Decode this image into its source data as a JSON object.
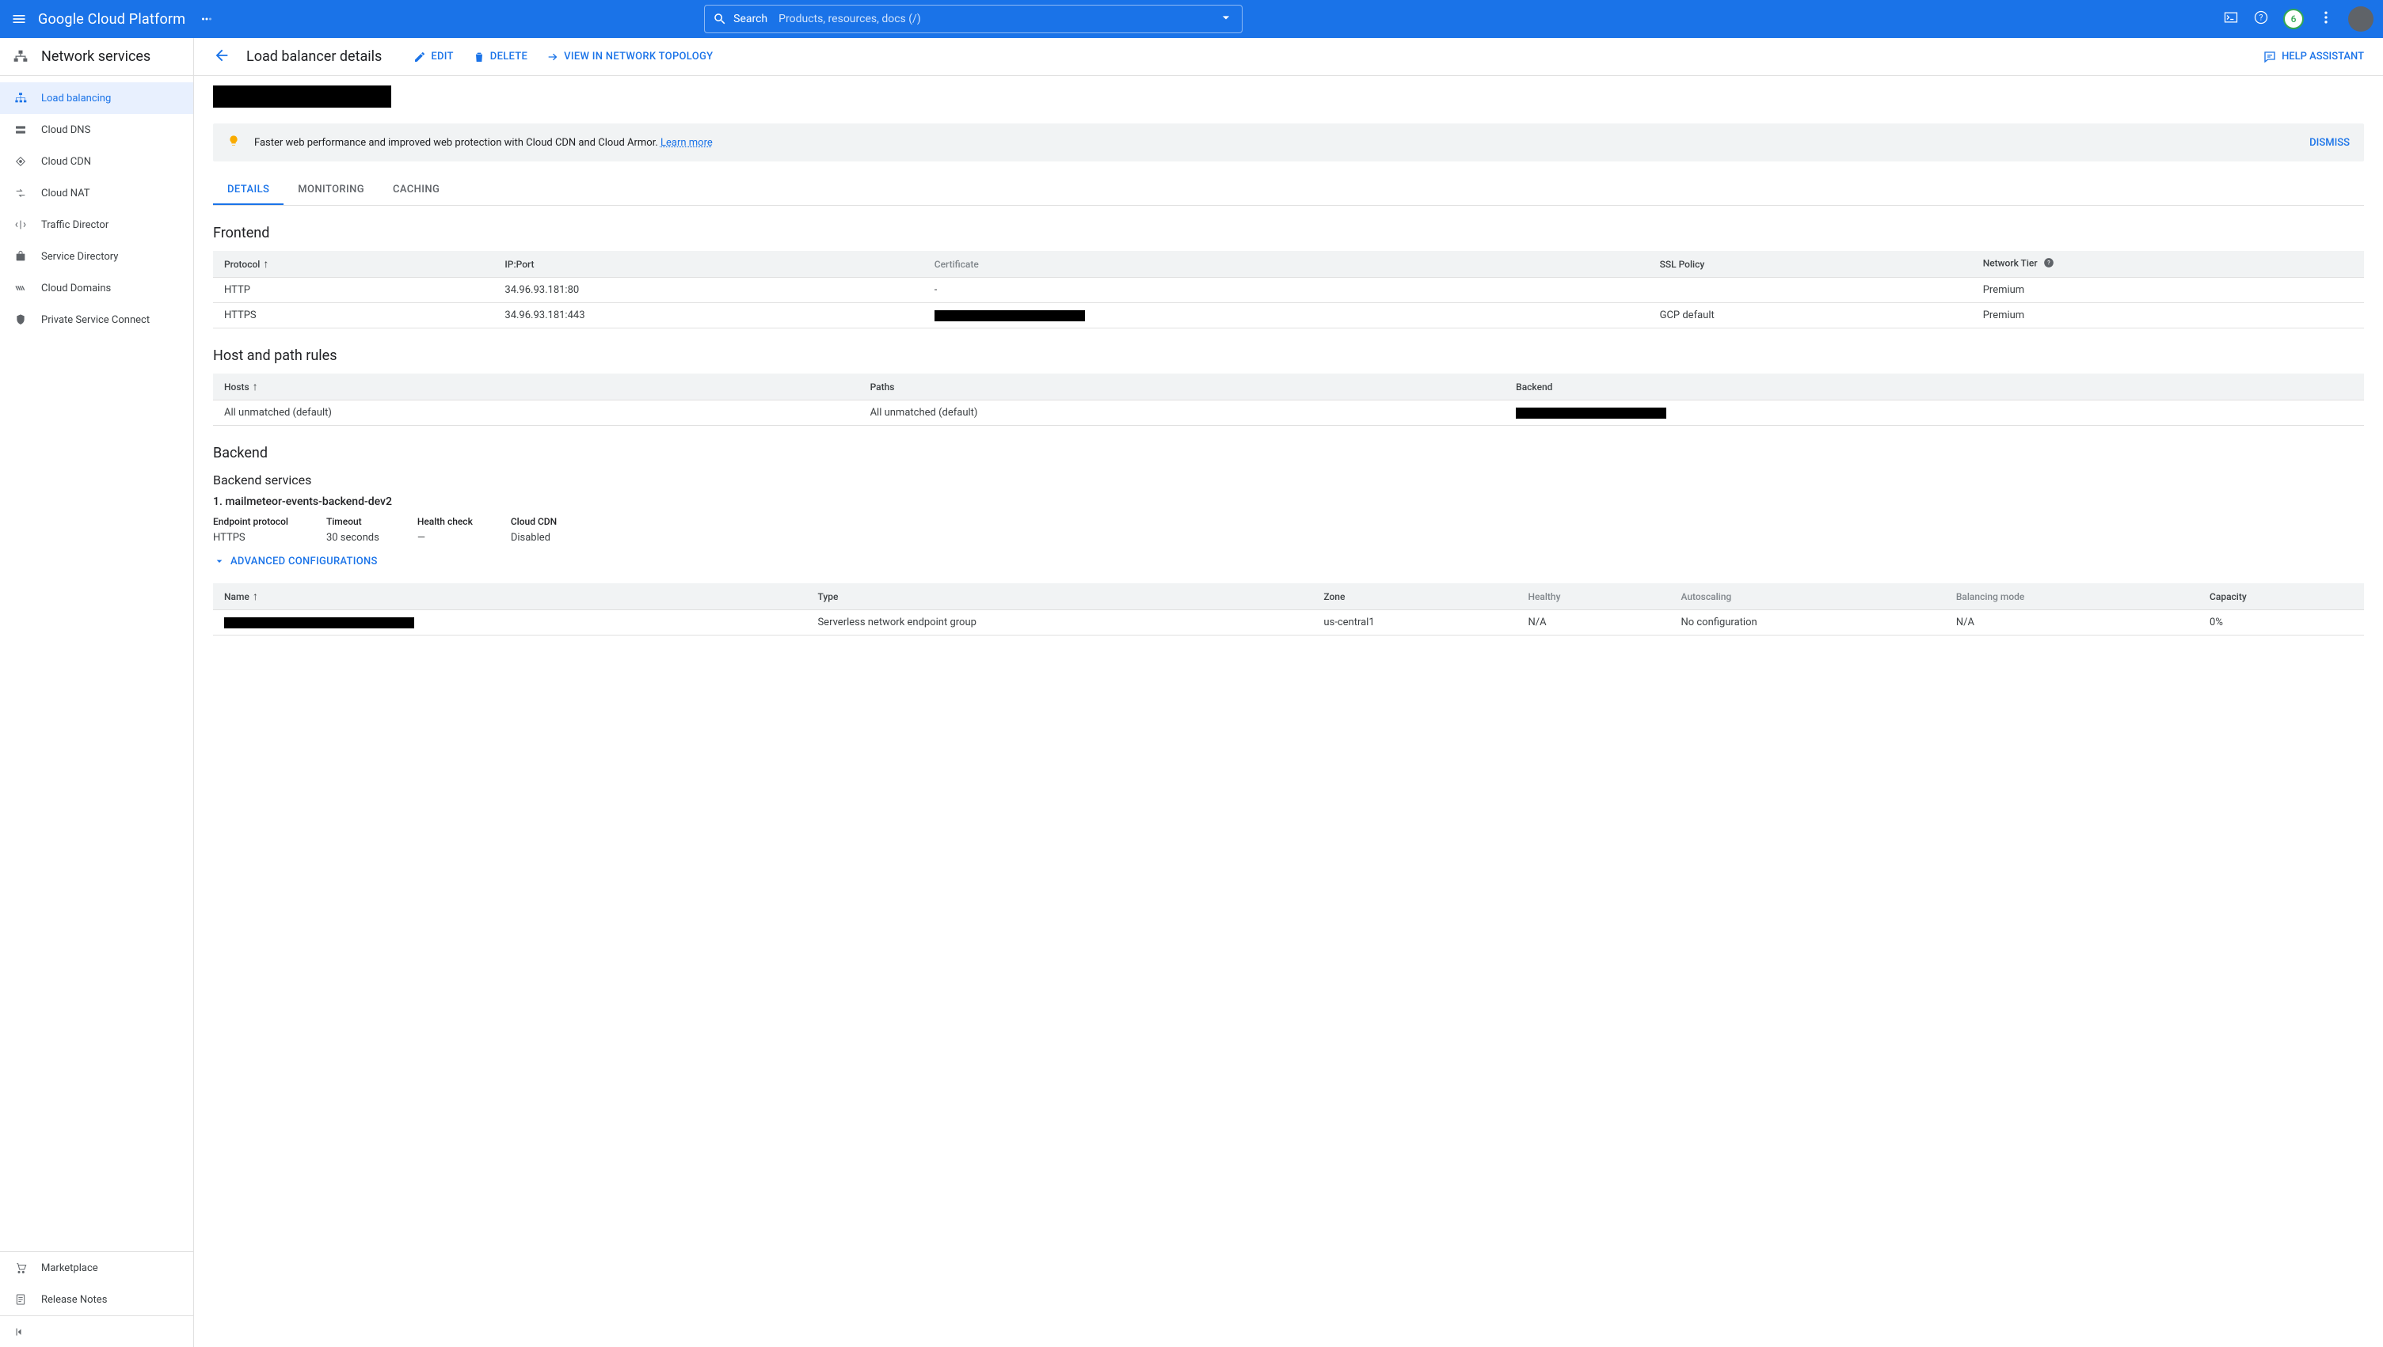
{
  "topbar": {
    "logo": "Google Cloud Platform",
    "search_label": "Search",
    "search_placeholder": "Products, resources, docs (/)",
    "badge": "6"
  },
  "sidebar": {
    "title": "Network services",
    "items": [
      {
        "label": "Load balancing"
      },
      {
        "label": "Cloud DNS"
      },
      {
        "label": "Cloud CDN"
      },
      {
        "label": "Cloud NAT"
      },
      {
        "label": "Traffic Director"
      },
      {
        "label": "Service Directory"
      },
      {
        "label": "Cloud Domains"
      },
      {
        "label": "Private Service Connect"
      }
    ],
    "bottom": [
      {
        "label": "Marketplace"
      },
      {
        "label": "Release Notes"
      }
    ]
  },
  "page": {
    "title": "Load balancer details",
    "actions": {
      "edit": "EDIT",
      "delete": "DELETE",
      "topology": "VIEW IN NETWORK TOPOLOGY"
    },
    "help": "HELP ASSISTANT"
  },
  "banner": {
    "text": "Faster web performance and improved web protection with Cloud CDN and Cloud Armor. ",
    "learn": "Learn more",
    "dismiss": "DISMISS"
  },
  "tabs": {
    "details": "DETAILS",
    "monitoring": "MONITORING",
    "caching": "CACHING"
  },
  "frontend": {
    "title": "Frontend",
    "cols": {
      "protocol": "Protocol",
      "ipport": "IP:Port",
      "cert": "Certificate",
      "ssl": "SSL Policy",
      "tier": "Network Tier"
    },
    "rows": [
      {
        "protocol": "HTTP",
        "ipport": "34.96.93.181:80",
        "cert": "-",
        "ssl": "",
        "tier": "Premium"
      },
      {
        "protocol": "HTTPS",
        "ipport": "34.96.93.181:443",
        "cert": "[redacted]",
        "ssl": "GCP default",
        "tier": "Premium"
      }
    ]
  },
  "hostpath": {
    "title": "Host and path rules",
    "cols": {
      "hosts": "Hosts",
      "paths": "Paths",
      "backend": "Backend"
    },
    "rows": [
      {
        "hosts": "All unmatched (default)",
        "paths": "All unmatched (default)",
        "backend": "[redacted]"
      }
    ]
  },
  "backend": {
    "title": "Backend",
    "services_title": "Backend services",
    "service": {
      "heading": "1. mailmeteor-events-backend-dev2",
      "meta": {
        "endpoint_k": "Endpoint protocol",
        "endpoint_v": "HTTPS",
        "timeout_k": "Timeout",
        "timeout_v": "30 seconds",
        "health_k": "Health check",
        "health_v": "—",
        "cdn_k": "Cloud CDN",
        "cdn_v": "Disabled"
      },
      "adv": "ADVANCED CONFIGURATIONS",
      "table": {
        "cols": {
          "name": "Name",
          "type": "Type",
          "zone": "Zone",
          "healthy": "Healthy",
          "autoscaling": "Autoscaling",
          "balmode": "Balancing mode",
          "capacity": "Capacity"
        },
        "row": {
          "name": "[redacted]",
          "type": "Serverless network endpoint group",
          "zone": "us-central1",
          "healthy": "N/A",
          "autoscaling": "No configuration",
          "balmode": "N/A",
          "capacity": "0%"
        }
      }
    }
  }
}
